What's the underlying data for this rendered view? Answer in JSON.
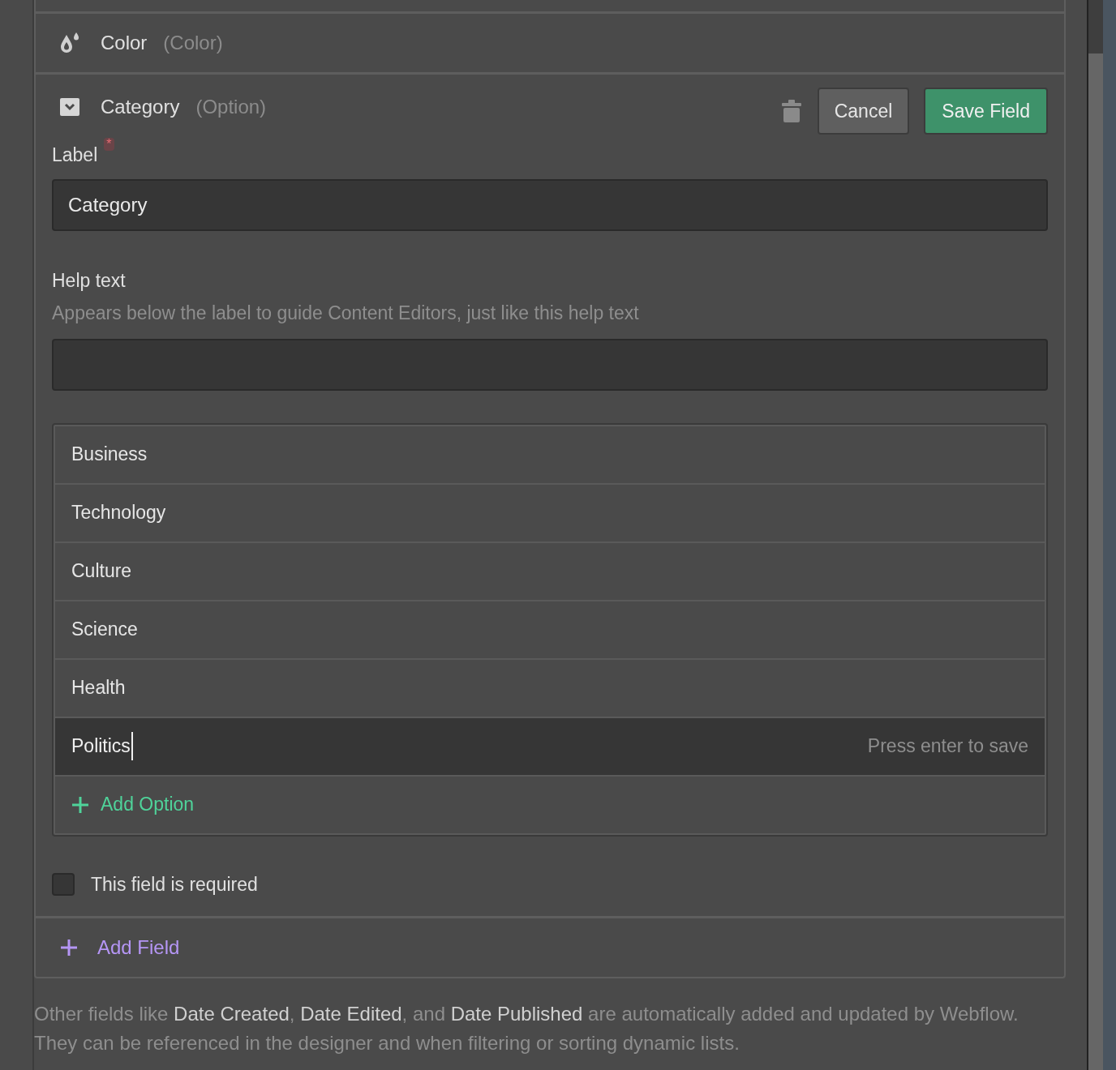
{
  "fields": [
    {
      "kind": "color",
      "name": "Color",
      "type": "(Color)",
      "expanded": false
    },
    {
      "kind": "option",
      "name": "Category",
      "type": "(Option)",
      "expanded": true
    }
  ],
  "editor": {
    "cancel": "Cancel",
    "save": "Save Field",
    "label_title": "Label",
    "label_required_mark": "*",
    "label_value": "Category",
    "help_title": "Help text",
    "help_description": "Appears below the label to guide Content Editors, just like this help text",
    "options": [
      {
        "text": "Business",
        "editing": false
      },
      {
        "text": "Technology",
        "editing": false
      },
      {
        "text": "Culture",
        "editing": false
      },
      {
        "text": "Science",
        "editing": false
      },
      {
        "text": "Health",
        "editing": false
      },
      {
        "text": "Politics",
        "editing": true,
        "hint": "Press enter to save"
      }
    ],
    "add_option": "Add Option",
    "required_label": "This field is required",
    "required_checked": false
  },
  "add_field": "Add Field",
  "footer": "Other fields like **Date Created**, **Date Edited**, and **Date Published** are automatically added and updated by Webflow. They can be referenced in the designer and when filtering or sorting dynamic lists."
}
